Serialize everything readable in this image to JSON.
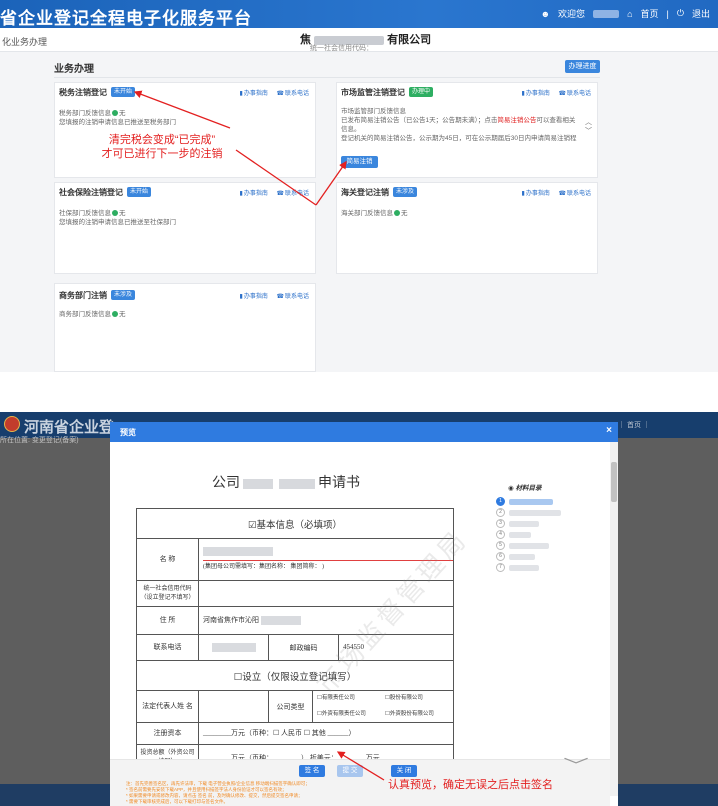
{
  "top": {
    "title": "省企业登记全程电子化服务平台",
    "user": {
      "welcome": "欢迎您",
      "home": "首页",
      "logout": "退出"
    },
    "crumb": "化业务办理",
    "company": {
      "suffix": "有限公司",
      "code_prefix": "统一社会信用代码："
    },
    "section_title": "业务办理",
    "progress_button": "办理进度",
    "cards": [
      {
        "name": "税务注销登记",
        "status": "未开始",
        "guide": "办事指南",
        "phone": "联系电话",
        "lines": [
          "税务部门反馈信息",
          "无",
          "您填报的注销申请信息已推送至税务部门"
        ]
      },
      {
        "name": "市场监管注销登记",
        "status": "办理中",
        "guide": "办事指南",
        "phone": "联系电话",
        "lines": [
          "市场监管部门反馈信息",
          "已发布简易注销公告（已公告1天；公告期未满）；点击",
          "简易注销公告",
          "可以查看相关信息。",
          "登记机关的简易注销公告，公示期为45日，可在公示期届后30日内申请简易注销程"
        ],
        "button": "简易注销"
      },
      {
        "name": "社会保险注销登记",
        "status": "未开始",
        "guide": "办事指南",
        "phone": "联系电话",
        "lines": [
          "社保部门反馈信息",
          "无",
          "您填报的注销申请信息已推送至社保部门"
        ]
      },
      {
        "name": "海关登记注销",
        "status": "未涉及",
        "guide": "办事指南",
        "phone": "联系电话",
        "lines": [
          "海关部门反馈信息",
          "无"
        ]
      },
      {
        "name": "商务部门注销",
        "status": "未涉及",
        "guide": "办事指南",
        "phone": "联系电话",
        "lines": [
          "商务部门反馈信息",
          "无"
        ]
      }
    ],
    "annotation": [
      "清完税会变成“已完成”",
      "才可已进行下一步的注销"
    ]
  },
  "bottom": {
    "bg_title": "河南省企业登",
    "bg_crumb": "所在位置: 变更登记(备案)",
    "bg_right": "｜  首页  ｜",
    "modal_title": "预览",
    "doc": {
      "title_prefix": "公司",
      "title_suffix": "申请书",
      "section1": "☑基本信息（必填项）",
      "name_label": "名 称",
      "name_hint": "(集团母公司需填写：集团名称：                集团简称：                 )",
      "credit_label": "统一社会信用代码（设立登记不填写）",
      "address_label": "住 所",
      "address_value": "河南省焦作市沁阳",
      "phone_label": "联系电话",
      "postcode_label": "邮政编码",
      "postcode_value": "454550",
      "section2": "☐设立（仅限设立登记填写）",
      "rep_label": "法定代表人姓 名",
      "type_label": "公司类型",
      "type_opts": [
        "☐有限责任公司",
        "☐股份有限公司",
        "☐外资有限责任公司",
        "☐外资股份有限公司"
      ],
      "capital_label": "注册资本",
      "capital_value": "________万元（币种：☐ 人民币 ☐ 其他 ______）",
      "invest_label": "投资总额（外资公司填写）",
      "invest_value": "________万元（币种：________）   折美元：________万元"
    },
    "toc_title": "材料目录",
    "toc_items": [
      "1",
      "2",
      "3",
      "4",
      "5",
      "6",
      "7"
    ],
    "buttons": {
      "sign": "签 名",
      "submit": "提 交",
      "close": "关 闭"
    },
    "notes": [
      "注：首先完善签名区，再先许法审，下载 电子营业执照/企业信息 移动端扫描签字确认即可；",
      "* 签名前需要先安装下载APP，并且使用扫描签字法人身份验证才可以签名有效；",
      "* 如果需要申请或修改内容，请点击 签名 前，及时确认修改、提交，然后提交签名申请；",
      "* 需要下载审核完成后，可以下载打印与签名文件。"
    ],
    "annotation": "认真预览，确定无误之后点击签名"
  },
  "colors": {
    "primary": "#2f7be0",
    "header": "#1b63b9",
    "annotation": "#e32020",
    "success": "#2eae62"
  }
}
